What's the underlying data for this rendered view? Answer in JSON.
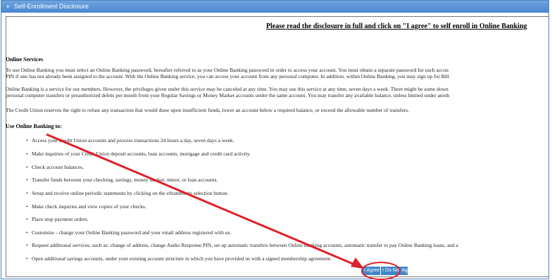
{
  "header": {
    "title": "Self-Enrollment Disclosure",
    "arrow": "▸"
  },
  "instruction": "Please read the disclosure in full and click on \"I agree\" to self enroll in Online Banking",
  "online_services": {
    "heading": "Online Services",
    "para1_line1": "To use Online Banking you must select an Online Banking password, hereafter referred to as your Online Banking password in order to access your account. You must obtain a separate password for each accou",
    "para1_line2": "PIN if one has not already been assigned to the account. With the Online Banking service, you can access your account from any personal computer. In addition, within Online Banking, you may sign up for Bill",
    "para2_line1": "Online Banking is a service for our members. However, the privileges given under this service may be canceled at any time. You may use this service at any time, seven days a week. There might be some down",
    "para2_line2": "personal computer transfers or preauthorized debits per month from your Regular Savings or Money Market accounts under the same account. You may transfer any available balance, unless limited under anoth",
    "para3": "The Credit Union reserves the right to refuse any transaction that would draw upon insufficient funds, lower an account below a required balance, or exceed the allowable number of transfers."
  },
  "use_online_banking": {
    "heading": "Use Online Banking to:",
    "items": [
      "Access your Credit Union accounts and process transactions 24 hours a day, seven days a week.",
      "Make inquiries of your Credit Union deposit accounts, loan accounts, mortgage and credit card activity.",
      "Check account balances.",
      "Transfer funds between your checking, savings, money market, minor, or loan accounts.",
      "Setup and receive online periodic statements by clicking on the eStatements selection button.",
      "Make check inquiries and view copies of your checks.",
      "Place stop payment orders.",
      "Customize - change your Online Banking password and your email address registered with us.",
      "Request additional services, such as: change of address, change Audio Response PIN, set up automatic transfers between Online Banking accounts, automatic transfer to pay Online Banking loans, and a",
      "Open additional savings accounts, under your existing account structure in which you have provided us with a signed membership agreement."
    ]
  },
  "buttons": {
    "agree": "I Agree",
    "do_not_agree": "I Do Not Agree"
  },
  "colors": {
    "header": "#4a86cf",
    "button": "#3f86ca",
    "annotation": "#e0202a"
  }
}
